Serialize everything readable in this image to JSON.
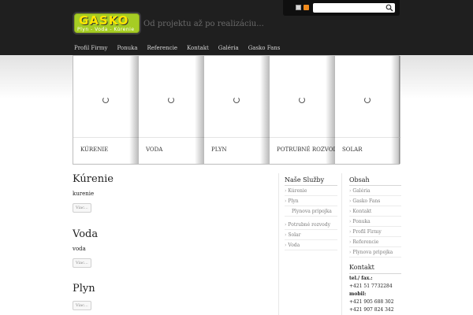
{
  "header": {
    "logo_word": "GASKO",
    "logo_sub": "Plyn - Voda - Kúrenie",
    "tagline": "Od projektu až po realizáciu..."
  },
  "nav": [
    "Profil Firmy",
    "Ponuka",
    "Referencie",
    "Kontakt",
    "Galéria",
    "Gasko Fans"
  ],
  "slider": {
    "panels": [
      "KÚRENIE",
      "VODA",
      "PLYN",
      "POTRUBNÉ ROZVODY",
      "SOLAR"
    ]
  },
  "content": {
    "sections": [
      {
        "title": "Kúrenie",
        "text": "kurenie",
        "button": "Viac..."
      },
      {
        "title": "Voda",
        "text": "voda",
        "button": "Viac..."
      },
      {
        "title": "Plyn",
        "text": "",
        "button": "Viac..."
      }
    ]
  },
  "sidebar_services": {
    "title": "Naše Služby",
    "items": [
      "Kúrenie",
      "Plyn",
      "Plynova pripojka",
      "Potrubné rozvody",
      "Solar",
      "Voda"
    ]
  },
  "sidebar_obsah": {
    "title": "Obsah",
    "items": [
      "Galéria",
      "Gasko Fans",
      "Kontakt",
      "Ponuka",
      "Profil Firmy",
      "Referencie",
      "Plynova pripojka"
    ]
  },
  "contact": {
    "title": "Kontakt",
    "lines": [
      "tel./ fax.:",
      "+421 51 7732284",
      "mobil:",
      "+421 905 688 302",
      "+421 907 824 342"
    ]
  },
  "colors": {
    "header_bg": "#1f1f1f",
    "logo_bg": "#a6cd24",
    "logo_text": "#ffe600"
  }
}
